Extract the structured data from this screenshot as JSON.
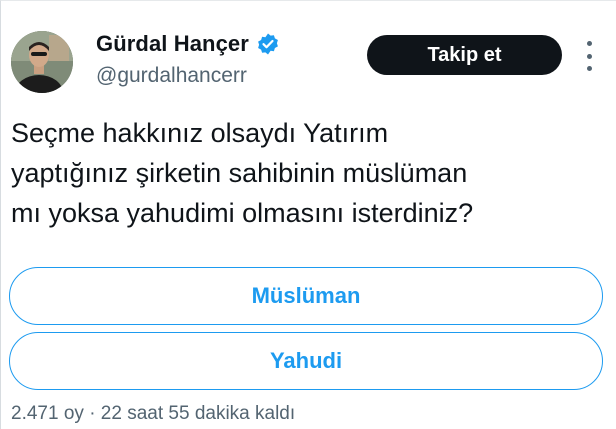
{
  "author": {
    "display_name": "Gürdal Hançer",
    "handle": "@gurdalhancerr",
    "verified_icon": "verified-badge-icon",
    "verified_color": "#1d9bf0"
  },
  "actions": {
    "follow_label": "Takip et",
    "more_icon": "more-options-icon"
  },
  "tweet": {
    "lines": [
      "Seçme hakkınız olsaydı Yatırım",
      "yaptığınız şirketin sahibinin müslüman",
      "mı yoksa yahudimi olmasını isterdiniz?"
    ]
  },
  "poll": {
    "options": [
      {
        "label": "Müslüman"
      },
      {
        "label": "Yahudi"
      }
    ],
    "votes": "2.471 oy",
    "separator": "·",
    "time_left": "22 saat 55 dakika kaldı"
  },
  "colors": {
    "accent": "#1d9bf0",
    "text": "#0f1419",
    "secondary": "#536471",
    "button_bg": "#0f1419"
  }
}
